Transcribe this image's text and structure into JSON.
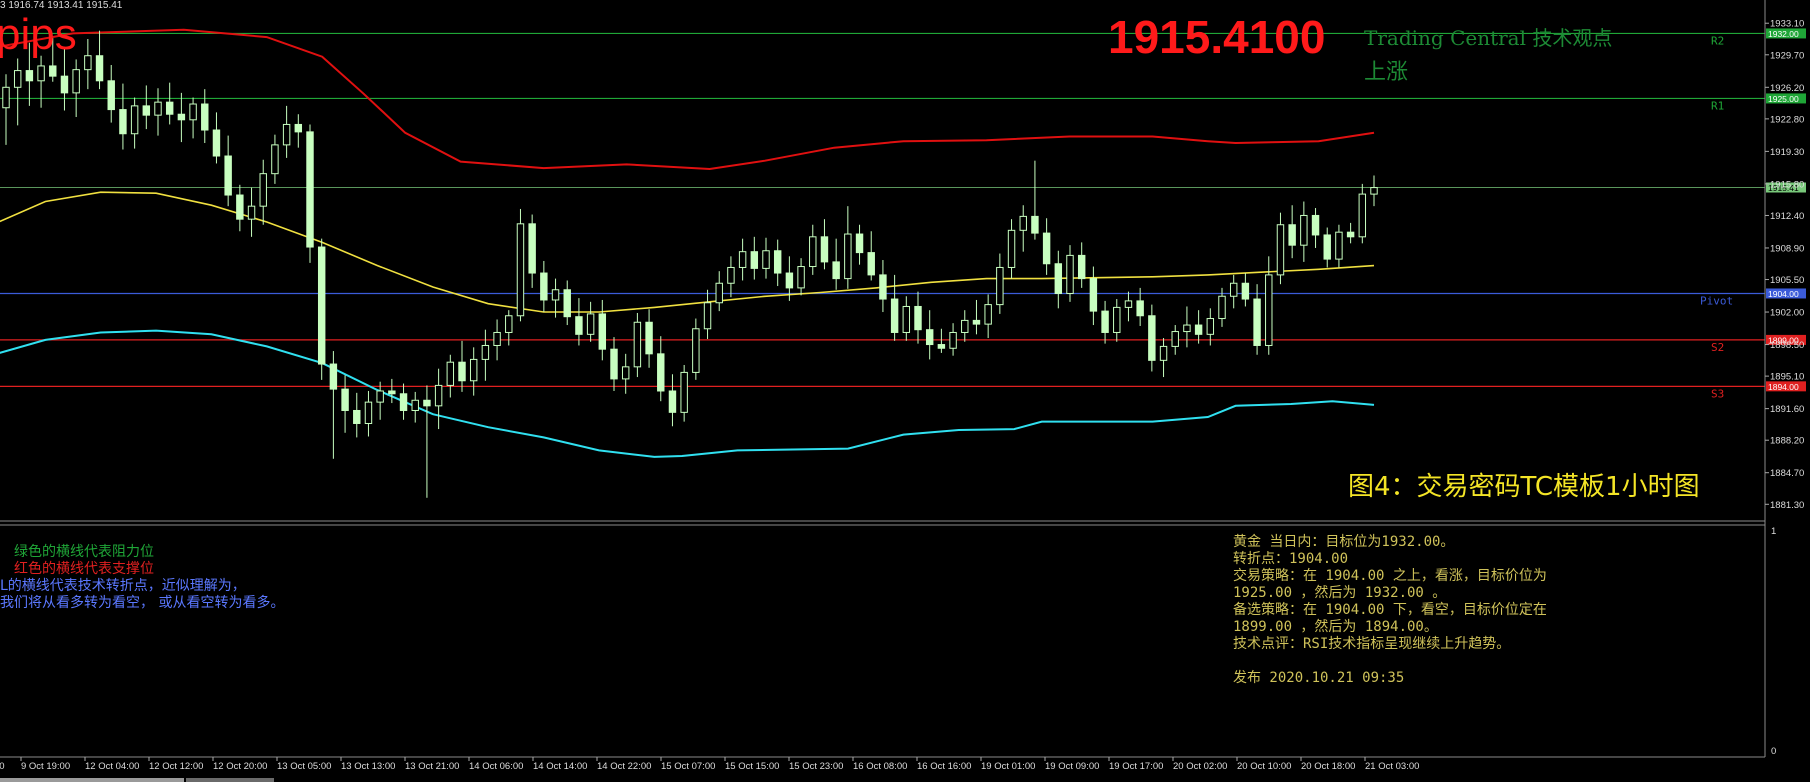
{
  "header": {
    "ohlc": "3 1916.74 1913.41 1915.41",
    "pips_label": "pips",
    "big_price": "1915.4100",
    "tc_view": "Trading Central 技术观点",
    "tc_direction": "上涨",
    "figure_caption": "图4：交易密码TC模板1小时图"
  },
  "legend_notes": [
    {
      "text": "绿色的横线代表阻力位",
      "color": "#1fa637"
    },
    {
      "text": "红色的横线代表支撑位",
      "color": "#e02020"
    },
    {
      "text": "L的横线代表技术转折点，近似理解为，",
      "color": "#5b78ff"
    },
    {
      "text": "我们将从看多转为看空， 或从看空转为看多。",
      "color": "#5b78ff"
    }
  ],
  "analysis": {
    "lines": [
      "黄金 当日内：目标位为1932.00。",
      "转折点：1904.00",
      "交易策略：在 1904.00 之上，看涨，目标价位为",
      "1925.00 ，然后为 1932.00 。",
      "备选策略：在 1904.00 下，看空，目标价位定在",
      "1899.00 ，然后为 1894.00。",
      "技术点评：RSI技术指标呈现继续上升趋势。",
      "",
      "发布 2020.10.21 09:35"
    ]
  },
  "colors": {
    "background": "#000000",
    "resistance": "#1fa637",
    "support": "#e02020",
    "pivot": "#3b5bd9",
    "current_price": "#79c97b",
    "candle": "#c8ffc0",
    "upper_band": "#e01010",
    "middle_band": "#f0e040",
    "lower_band": "#30e0f0",
    "axis_text": "#dddddd"
  },
  "chart_data": {
    "type": "candlestick",
    "symbol_price": 1915.41,
    "ylim": [
      1879.5,
      1935.6
    ],
    "y_ticks": [
      1881.3,
      1884.7,
      1888.2,
      1891.6,
      1895.1,
      1898.5,
      1902.0,
      1905.5,
      1908.9,
      1912.4,
      1915.8,
      1919.3,
      1922.8,
      1926.2,
      1929.7,
      1933.1
    ],
    "x_ticks": [
      "9 Oct 19:00",
      "12 Oct 04:00",
      "12 Oct 12:00",
      "12 Oct 20:00",
      "13 Oct 05:00",
      "13 Oct 13:00",
      "13 Oct 21:00",
      "14 Oct 06:00",
      "14 Oct 14:00",
      "14 Oct 22:00",
      "15 Oct 07:00",
      "15 Oct 15:00",
      "15 Oct 23:00",
      "16 Oct 08:00",
      "16 Oct 16:00",
      "19 Oct 01:00",
      "19 Oct 09:00",
      "19 Oct 17:00",
      "20 Oct 02:00",
      "20 Oct 10:00",
      "20 Oct 18:00",
      "21 Oct 03:00"
    ],
    "levels": [
      {
        "name": "R2",
        "value": 1932.0,
        "label": "1932.00",
        "kind": "resistance"
      },
      {
        "name": "R1",
        "value": 1925.0,
        "label": "1925.00",
        "kind": "resistance"
      },
      {
        "name": "",
        "value": 1915.41,
        "label": "1915.41",
        "kind": "current"
      },
      {
        "name": "Pivot",
        "value": 1904.0,
        "label": "1904.00",
        "kind": "pivot"
      },
      {
        "name": "S2",
        "value": 1899.0,
        "label": "1899.00",
        "kind": "support"
      },
      {
        "name": "S3",
        "value": 1894.0,
        "label": "1894.00",
        "kind": "support"
      }
    ],
    "candles": [
      {
        "o": 1924.0,
        "h": 1927.6,
        "l": 1920.0,
        "c": 1926.2
      },
      {
        "o": 1926.2,
        "h": 1929.3,
        "l": 1922.1,
        "c": 1928.0
      },
      {
        "o": 1928.0,
        "h": 1931.0,
        "l": 1924.2,
        "c": 1926.9
      },
      {
        "o": 1926.9,
        "h": 1929.6,
        "l": 1924.0,
        "c": 1928.5
      },
      {
        "o": 1928.5,
        "h": 1931.5,
        "l": 1926.8,
        "c": 1927.4
      },
      {
        "o": 1927.4,
        "h": 1930.3,
        "l": 1923.7,
        "c": 1925.6
      },
      {
        "o": 1925.6,
        "h": 1929.2,
        "l": 1923.0,
        "c": 1928.1
      },
      {
        "o": 1928.1,
        "h": 1931.4,
        "l": 1926.0,
        "c": 1929.6
      },
      {
        "o": 1929.6,
        "h": 1932.3,
        "l": 1926.0,
        "c": 1926.9
      },
      {
        "o": 1926.9,
        "h": 1928.6,
        "l": 1922.4,
        "c": 1923.8
      },
      {
        "o": 1923.8,
        "h": 1926.6,
        "l": 1919.5,
        "c": 1921.2
      },
      {
        "o": 1921.2,
        "h": 1925.1,
        "l": 1919.6,
        "c": 1924.2
      },
      {
        "o": 1924.2,
        "h": 1926.4,
        "l": 1921.7,
        "c": 1923.2
      },
      {
        "o": 1923.2,
        "h": 1926.1,
        "l": 1921.0,
        "c": 1924.6
      },
      {
        "o": 1924.6,
        "h": 1926.7,
        "l": 1922.2,
        "c": 1923.3
      },
      {
        "o": 1923.3,
        "h": 1925.6,
        "l": 1920.3,
        "c": 1922.7
      },
      {
        "o": 1922.7,
        "h": 1925.1,
        "l": 1920.7,
        "c": 1924.4
      },
      {
        "o": 1924.4,
        "h": 1926.0,
        "l": 1920.2,
        "c": 1921.6
      },
      {
        "o": 1921.6,
        "h": 1923.5,
        "l": 1918.0,
        "c": 1918.8
      },
      {
        "o": 1918.8,
        "h": 1921.0,
        "l": 1913.4,
        "c": 1914.6
      },
      {
        "o": 1914.6,
        "h": 1915.7,
        "l": 1910.7,
        "c": 1912.0
      },
      {
        "o": 1912.0,
        "h": 1915.4,
        "l": 1910.1,
        "c": 1913.4
      },
      {
        "o": 1913.4,
        "h": 1918.4,
        "l": 1911.4,
        "c": 1916.9
      },
      {
        "o": 1916.9,
        "h": 1921.1,
        "l": 1915.8,
        "c": 1920.0
      },
      {
        "o": 1920.0,
        "h": 1924.2,
        "l": 1918.6,
        "c": 1922.2
      },
      {
        "o": 1922.2,
        "h": 1923.3,
        "l": 1919.7,
        "c": 1921.4
      },
      {
        "o": 1921.4,
        "h": 1922.2,
        "l": 1907.3,
        "c": 1909.0
      },
      {
        "o": 1909.0,
        "h": 1909.9,
        "l": 1894.7,
        "c": 1896.4
      },
      {
        "o": 1896.4,
        "h": 1897.8,
        "l": 1886.2,
        "c": 1893.7
      },
      {
        "o": 1893.7,
        "h": 1895.2,
        "l": 1889.0,
        "c": 1891.4
      },
      {
        "o": 1891.4,
        "h": 1893.3,
        "l": 1888.5,
        "c": 1890.0
      },
      {
        "o": 1890.0,
        "h": 1893.5,
        "l": 1888.6,
        "c": 1892.3
      },
      {
        "o": 1892.3,
        "h": 1894.5,
        "l": 1890.4,
        "c": 1893.5
      },
      {
        "o": 1893.5,
        "h": 1894.8,
        "l": 1892.2,
        "c": 1893.2
      },
      {
        "o": 1893.2,
        "h": 1894.3,
        "l": 1890.4,
        "c": 1891.4
      },
      {
        "o": 1891.4,
        "h": 1893.4,
        "l": 1890.1,
        "c": 1892.5
      },
      {
        "o": 1892.5,
        "h": 1894.1,
        "l": 1882.0,
        "c": 1891.9
      },
      {
        "o": 1891.9,
        "h": 1895.9,
        "l": 1889.4,
        "c": 1894.1
      },
      {
        "o": 1894.1,
        "h": 1897.4,
        "l": 1892.8,
        "c": 1896.6
      },
      {
        "o": 1896.6,
        "h": 1898.9,
        "l": 1893.4,
        "c": 1894.6
      },
      {
        "o": 1894.6,
        "h": 1898.2,
        "l": 1893.0,
        "c": 1896.9
      },
      {
        "o": 1896.9,
        "h": 1900.1,
        "l": 1894.6,
        "c": 1898.4
      },
      {
        "o": 1898.4,
        "h": 1901.2,
        "l": 1896.8,
        "c": 1899.8
      },
      {
        "o": 1899.8,
        "h": 1902.2,
        "l": 1898.4,
        "c": 1901.6
      },
      {
        "o": 1901.6,
        "h": 1913.1,
        "l": 1901.0,
        "c": 1911.5
      },
      {
        "o": 1911.5,
        "h": 1912.5,
        "l": 1904.6,
        "c": 1906.2
      },
      {
        "o": 1906.2,
        "h": 1907.5,
        "l": 1902.0,
        "c": 1903.3
      },
      {
        "o": 1903.3,
        "h": 1905.6,
        "l": 1901.4,
        "c": 1904.4
      },
      {
        "o": 1904.4,
        "h": 1905.4,
        "l": 1900.6,
        "c": 1901.5
      },
      {
        "o": 1901.5,
        "h": 1903.5,
        "l": 1898.4,
        "c": 1899.6
      },
      {
        "o": 1899.6,
        "h": 1903.1,
        "l": 1898.8,
        "c": 1901.8
      },
      {
        "o": 1901.8,
        "h": 1903.3,
        "l": 1896.8,
        "c": 1898.0
      },
      {
        "o": 1898.0,
        "h": 1899.3,
        "l": 1893.5,
        "c": 1894.8
      },
      {
        "o": 1894.8,
        "h": 1897.5,
        "l": 1893.2,
        "c": 1896.1
      },
      {
        "o": 1896.1,
        "h": 1901.9,
        "l": 1895.0,
        "c": 1900.9
      },
      {
        "o": 1900.9,
        "h": 1902.3,
        "l": 1896.0,
        "c": 1897.5
      },
      {
        "o": 1897.5,
        "h": 1899.4,
        "l": 1892.4,
        "c": 1893.5
      },
      {
        "o": 1893.5,
        "h": 1895.3,
        "l": 1889.7,
        "c": 1891.2
      },
      {
        "o": 1891.2,
        "h": 1896.3,
        "l": 1890.2,
        "c": 1895.5
      },
      {
        "o": 1895.5,
        "h": 1901.3,
        "l": 1894.7,
        "c": 1900.2
      },
      {
        "o": 1900.2,
        "h": 1904.4,
        "l": 1899.1,
        "c": 1903.0
      },
      {
        "o": 1903.0,
        "h": 1906.4,
        "l": 1902.1,
        "c": 1905.1
      },
      {
        "o": 1905.1,
        "h": 1908.0,
        "l": 1903.6,
        "c": 1906.8
      },
      {
        "o": 1906.8,
        "h": 1909.9,
        "l": 1905.4,
        "c": 1908.5
      },
      {
        "o": 1908.5,
        "h": 1910.1,
        "l": 1905.5,
        "c": 1906.7
      },
      {
        "o": 1906.7,
        "h": 1910.0,
        "l": 1905.6,
        "c": 1908.6
      },
      {
        "o": 1908.6,
        "h": 1909.8,
        "l": 1904.8,
        "c": 1906.2
      },
      {
        "o": 1906.2,
        "h": 1908.0,
        "l": 1903.2,
        "c": 1904.6
      },
      {
        "o": 1904.6,
        "h": 1907.8,
        "l": 1903.8,
        "c": 1906.9
      },
      {
        "o": 1906.9,
        "h": 1911.4,
        "l": 1906.0,
        "c": 1910.1
      },
      {
        "o": 1910.1,
        "h": 1912.0,
        "l": 1906.6,
        "c": 1907.4
      },
      {
        "o": 1907.4,
        "h": 1909.9,
        "l": 1904.4,
        "c": 1905.6
      },
      {
        "o": 1905.6,
        "h": 1913.4,
        "l": 1904.5,
        "c": 1910.4
      },
      {
        "o": 1910.4,
        "h": 1911.4,
        "l": 1907.1,
        "c": 1908.4
      },
      {
        "o": 1908.4,
        "h": 1910.7,
        "l": 1905.4,
        "c": 1906.0
      },
      {
        "o": 1906.0,
        "h": 1907.6,
        "l": 1902.0,
        "c": 1903.4
      },
      {
        "o": 1903.4,
        "h": 1906.0,
        "l": 1898.9,
        "c": 1899.8
      },
      {
        "o": 1899.8,
        "h": 1903.7,
        "l": 1898.9,
        "c": 1902.6
      },
      {
        "o": 1902.6,
        "h": 1904.2,
        "l": 1898.6,
        "c": 1900.1
      },
      {
        "o": 1900.1,
        "h": 1902.2,
        "l": 1896.9,
        "c": 1898.5
      },
      {
        "o": 1898.5,
        "h": 1900.2,
        "l": 1897.6,
        "c": 1898.1
      },
      {
        "o": 1898.1,
        "h": 1900.8,
        "l": 1897.3,
        "c": 1899.8
      },
      {
        "o": 1899.8,
        "h": 1902.2,
        "l": 1898.8,
        "c": 1901.1
      },
      {
        "o": 1901.1,
        "h": 1903.3,
        "l": 1899.6,
        "c": 1900.7
      },
      {
        "o": 1900.7,
        "h": 1903.9,
        "l": 1899.2,
        "c": 1902.8
      },
      {
        "o": 1902.8,
        "h": 1908.3,
        "l": 1901.8,
        "c": 1906.8
      },
      {
        "o": 1906.8,
        "h": 1912.0,
        "l": 1905.6,
        "c": 1910.8
      },
      {
        "o": 1910.8,
        "h": 1913.5,
        "l": 1908.5,
        "c": 1912.3
      },
      {
        "o": 1912.3,
        "h": 1918.3,
        "l": 1909.8,
        "c": 1910.5
      },
      {
        "o": 1910.5,
        "h": 1912.1,
        "l": 1906.0,
        "c": 1907.2
      },
      {
        "o": 1907.2,
        "h": 1908.6,
        "l": 1902.4,
        "c": 1904.0
      },
      {
        "o": 1904.0,
        "h": 1909.2,
        "l": 1903.1,
        "c": 1908.1
      },
      {
        "o": 1908.1,
        "h": 1909.5,
        "l": 1904.6,
        "c": 1905.6
      },
      {
        "o": 1905.6,
        "h": 1906.9,
        "l": 1900.6,
        "c": 1902.1
      },
      {
        "o": 1902.1,
        "h": 1903.2,
        "l": 1898.6,
        "c": 1899.8
      },
      {
        "o": 1899.8,
        "h": 1903.4,
        "l": 1898.8,
        "c": 1902.5
      },
      {
        "o": 1902.5,
        "h": 1904.2,
        "l": 1901.0,
        "c": 1903.2
      },
      {
        "o": 1903.2,
        "h": 1904.6,
        "l": 1900.5,
        "c": 1901.6
      },
      {
        "o": 1901.6,
        "h": 1902.8,
        "l": 1895.6,
        "c": 1896.8
      },
      {
        "o": 1896.8,
        "h": 1899.2,
        "l": 1895.0,
        "c": 1898.3
      },
      {
        "o": 1898.3,
        "h": 1900.6,
        "l": 1897.4,
        "c": 1899.9
      },
      {
        "o": 1899.9,
        "h": 1902.6,
        "l": 1898.2,
        "c": 1900.6
      },
      {
        "o": 1900.6,
        "h": 1902.2,
        "l": 1898.6,
        "c": 1899.6
      },
      {
        "o": 1899.6,
        "h": 1902.4,
        "l": 1898.4,
        "c": 1901.3
      },
      {
        "o": 1901.3,
        "h": 1904.6,
        "l": 1900.4,
        "c": 1903.7
      },
      {
        "o": 1903.7,
        "h": 1906.0,
        "l": 1902.4,
        "c": 1905.1
      },
      {
        "o": 1905.1,
        "h": 1906.2,
        "l": 1902.6,
        "c": 1903.4
      },
      {
        "o": 1903.4,
        "h": 1905.0,
        "l": 1897.4,
        "c": 1898.4
      },
      {
        "o": 1898.4,
        "h": 1908.0,
        "l": 1897.4,
        "c": 1906.0
      },
      {
        "o": 1906.0,
        "h": 1912.7,
        "l": 1905.0,
        "c": 1911.4
      },
      {
        "o": 1911.4,
        "h": 1913.5,
        "l": 1907.8,
        "c": 1909.2
      },
      {
        "o": 1909.2,
        "h": 1913.9,
        "l": 1907.4,
        "c": 1912.4
      },
      {
        "o": 1912.4,
        "h": 1913.2,
        "l": 1908.9,
        "c": 1910.3
      },
      {
        "o": 1910.3,
        "h": 1911.1,
        "l": 1906.8,
        "c": 1907.7
      },
      {
        "o": 1907.7,
        "h": 1911.4,
        "l": 1906.8,
        "c": 1910.6
      },
      {
        "o": 1910.6,
        "h": 1911.6,
        "l": 1909.4,
        "c": 1910.1
      },
      {
        "o": 1910.1,
        "h": 1915.8,
        "l": 1909.4,
        "c": 1914.7
      },
      {
        "o": 1914.7,
        "h": 1916.7,
        "l": 1913.4,
        "c": 1915.4
      }
    ],
    "bands": {
      "upper": [
        [
          0,
          1930.4
        ],
        [
          0.06,
          1932.0
        ],
        [
          0.14,
          1932.4
        ],
        [
          0.2,
          1931.6
        ],
        [
          0.24,
          1929.5
        ],
        [
          0.27,
          1925.5
        ],
        [
          0.3,
          1921.3
        ],
        [
          0.34,
          1918.2
        ],
        [
          0.4,
          1917.5
        ],
        [
          0.46,
          1917.9
        ],
        [
          0.52,
          1917.4
        ],
        [
          0.56,
          1918.3
        ],
        [
          0.61,
          1919.7
        ],
        [
          0.66,
          1920.4
        ],
        [
          0.72,
          1920.5
        ],
        [
          0.78,
          1920.9
        ],
        [
          0.84,
          1920.9
        ],
        [
          0.88,
          1920.4
        ],
        [
          0.9,
          1920.2
        ],
        [
          0.93,
          1920.3
        ],
        [
          0.96,
          1920.4
        ],
        [
          1,
          1921.3
        ]
      ],
      "middle": [
        [
          0,
          1911.3
        ],
        [
          0.04,
          1913.9
        ],
        [
          0.08,
          1914.9
        ],
        [
          0.12,
          1914.8
        ],
        [
          0.16,
          1913.5
        ],
        [
          0.2,
          1911.7
        ],
        [
          0.24,
          1909.5
        ],
        [
          0.28,
          1907.0
        ],
        [
          0.32,
          1904.7
        ],
        [
          0.36,
          1902.9
        ],
        [
          0.4,
          1902.0
        ],
        [
          0.44,
          1902.0
        ],
        [
          0.48,
          1902.5
        ],
        [
          0.52,
          1903.1
        ],
        [
          0.56,
          1903.7
        ],
        [
          0.6,
          1904.1
        ],
        [
          0.64,
          1904.6
        ],
        [
          0.68,
          1905.2
        ],
        [
          0.72,
          1905.6
        ],
        [
          0.76,
          1905.6
        ],
        [
          0.8,
          1905.7
        ],
        [
          0.84,
          1905.8
        ],
        [
          0.88,
          1906.0
        ],
        [
          0.92,
          1906.3
        ],
        [
          0.96,
          1906.6
        ],
        [
          1,
          1907.0
        ]
      ],
      "lower": [
        [
          0,
          1897.3
        ],
        [
          0.04,
          1899.0
        ],
        [
          0.08,
          1899.8
        ],
        [
          0.12,
          1900.0
        ],
        [
          0.16,
          1899.6
        ],
        [
          0.2,
          1898.3
        ],
        [
          0.24,
          1896.5
        ],
        [
          0.28,
          1893.6
        ],
        [
          0.32,
          1891.0
        ],
        [
          0.36,
          1889.6
        ],
        [
          0.4,
          1888.5
        ],
        [
          0.44,
          1887.1
        ],
        [
          0.48,
          1886.4
        ],
        [
          0.5,
          1886.5
        ],
        [
          0.54,
          1887.1
        ],
        [
          0.58,
          1887.2
        ],
        [
          0.62,
          1887.3
        ],
        [
          0.66,
          1888.8
        ],
        [
          0.7,
          1889.3
        ],
        [
          0.74,
          1889.4
        ],
        [
          0.76,
          1890.2
        ],
        [
          0.8,
          1890.2
        ],
        [
          0.84,
          1890.2
        ],
        [
          0.88,
          1890.7
        ],
        [
          0.9,
          1891.9
        ],
        [
          0.94,
          1892.1
        ],
        [
          0.97,
          1892.4
        ],
        [
          1,
          1892.0
        ]
      ]
    },
    "subpanel": {
      "top_label": "1",
      "bottom_label": "0"
    }
  }
}
